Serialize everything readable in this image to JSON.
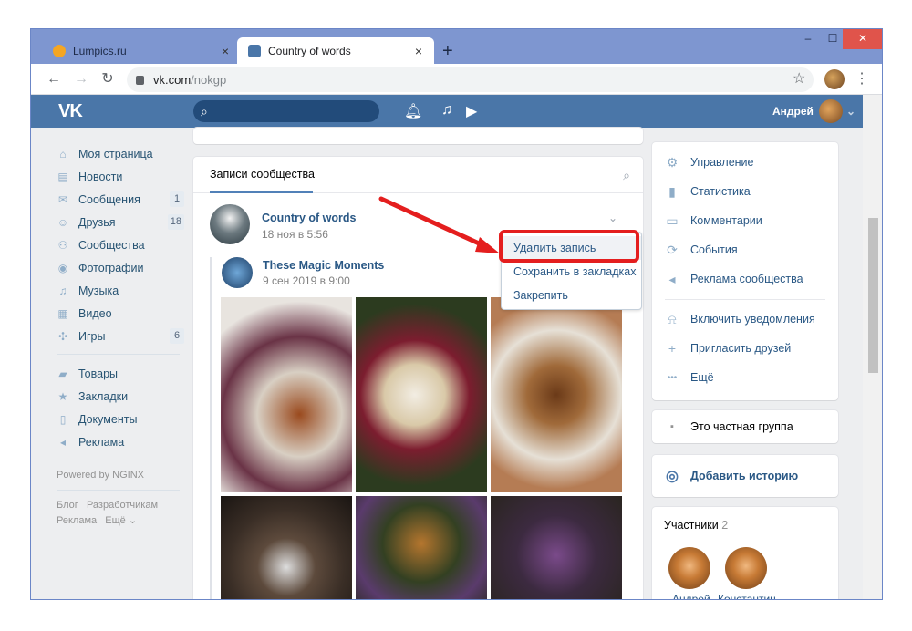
{
  "browser": {
    "tabs": [
      {
        "title": "Lumpics.ru",
        "active": false,
        "favicon_color": "#f5a623"
      },
      {
        "title": "Country of words",
        "active": true,
        "favicon_color": "#4a76a8"
      }
    ],
    "new_tab": "+",
    "close_tab": "×",
    "window_controls": {
      "minimize": "–",
      "maximize": "☐",
      "close": "✕"
    },
    "nav": {
      "back": "←",
      "forward": "→",
      "reload": "↻"
    },
    "url_host": "vk.com",
    "url_path": "/nokgp",
    "star": "☆",
    "menu": "⋮"
  },
  "vk_header": {
    "logo": "VK",
    "search_icon": "⌕",
    "icons": [
      "bell-icon",
      "music-icon",
      "video-icon"
    ],
    "user_name": "Андрей",
    "user_chevron": "⌄"
  },
  "left_menu": {
    "items": [
      {
        "label": "Моя страница",
        "icon": "⌂",
        "count": ""
      },
      {
        "label": "Новости",
        "icon": "▤",
        "count": ""
      },
      {
        "label": "Сообщения",
        "icon": "✉",
        "count": "1"
      },
      {
        "label": "Друзья",
        "icon": "☺",
        "count": "18"
      },
      {
        "label": "Сообщества",
        "icon": "⚇",
        "count": ""
      },
      {
        "label": "Фотографии",
        "icon": "◉",
        "count": ""
      },
      {
        "label": "Музыка",
        "icon": "♫",
        "count": ""
      },
      {
        "label": "Видео",
        "icon": "▦",
        "count": ""
      },
      {
        "label": "Игры",
        "icon": "✣",
        "count": "6"
      }
    ],
    "items2": [
      {
        "label": "Товары",
        "icon": "▰"
      },
      {
        "label": "Закладки",
        "icon": "★"
      },
      {
        "label": "Документы",
        "icon": "▯"
      },
      {
        "label": "Реклама",
        "icon": "◂"
      }
    ],
    "powered": "Powered by NGINX",
    "footer1": [
      "Блог",
      "Разработчикам"
    ],
    "footer2": [
      "Реклама",
      "Ещё ⌄"
    ]
  },
  "feed": {
    "tab_label": "Записи сообщества",
    "search_icon": "⌕",
    "post": {
      "author": "Country of words",
      "date": "18 ноя в 5:56",
      "chevron": "⌄"
    },
    "repost": {
      "author": "These Magic Moments",
      "date": "9 сен 2019 в 9:00"
    }
  },
  "dropdown": {
    "items": [
      "Удалить запись",
      "Сохранить в закладках",
      "Закрепить"
    ]
  },
  "annotation_color": "#e41e1e",
  "right_panel": {
    "items": [
      {
        "label": "Управление",
        "icon": "⚙"
      },
      {
        "label": "Статистика",
        "icon": "▮"
      },
      {
        "label": "Комментарии",
        "icon": "▭"
      },
      {
        "label": "События",
        "icon": "⟳"
      },
      {
        "label": "Реклама сообщества",
        "icon": "◂"
      }
    ],
    "items2": [
      {
        "label": "Включить уведомления",
        "icon": "⍾"
      },
      {
        "label": "Пригласить друзей",
        "icon": "+"
      },
      {
        "label": "Ещё",
        "icon": "•••"
      }
    ],
    "private": {
      "label": "Это частная группа",
      "icon": "▪"
    },
    "story": {
      "label": "Добавить историю",
      "icon": "◎"
    },
    "members": {
      "title": "Участники",
      "count": "2",
      "names": [
        "Андрей",
        "Константин"
      ]
    }
  }
}
